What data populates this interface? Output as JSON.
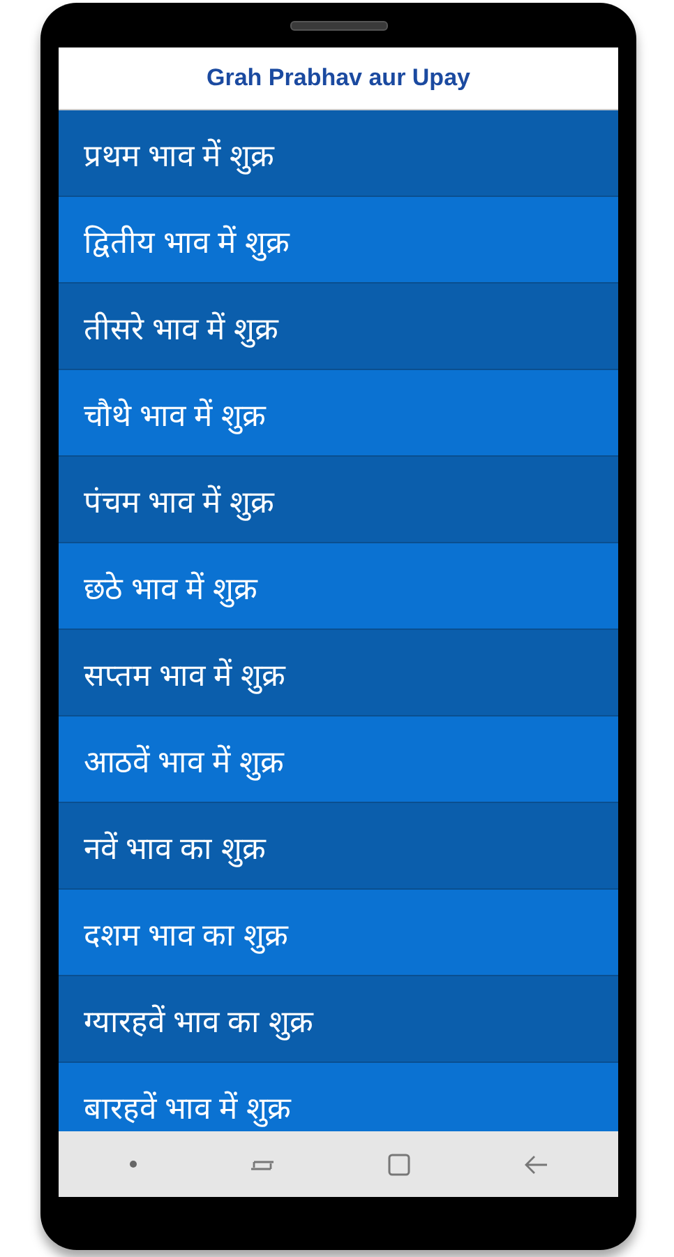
{
  "app_bar": {
    "title": "Grah Prabhav aur Upay"
  },
  "items": [
    {
      "label": "प्रथम भाव में शुक्र"
    },
    {
      "label": "द्वितीय भाव में शुक्र"
    },
    {
      "label": "तीसरे भाव में शुक्र"
    },
    {
      "label": "चौथे भाव में शुक्र"
    },
    {
      "label": "पंचम भाव में शुक्र"
    },
    {
      "label": "छठे भाव में शुक्र"
    },
    {
      "label": "सप्तम भाव में शुक्र"
    },
    {
      "label": "आठवें भाव में शुक्र"
    },
    {
      "label": "नवें भाव का शुक्र"
    },
    {
      "label": "दशम भाव का शुक्र"
    },
    {
      "label": "ग्यारहवें भाव का शुक्र"
    },
    {
      "label": "बारहवें भाव में शुक्र"
    }
  ]
}
